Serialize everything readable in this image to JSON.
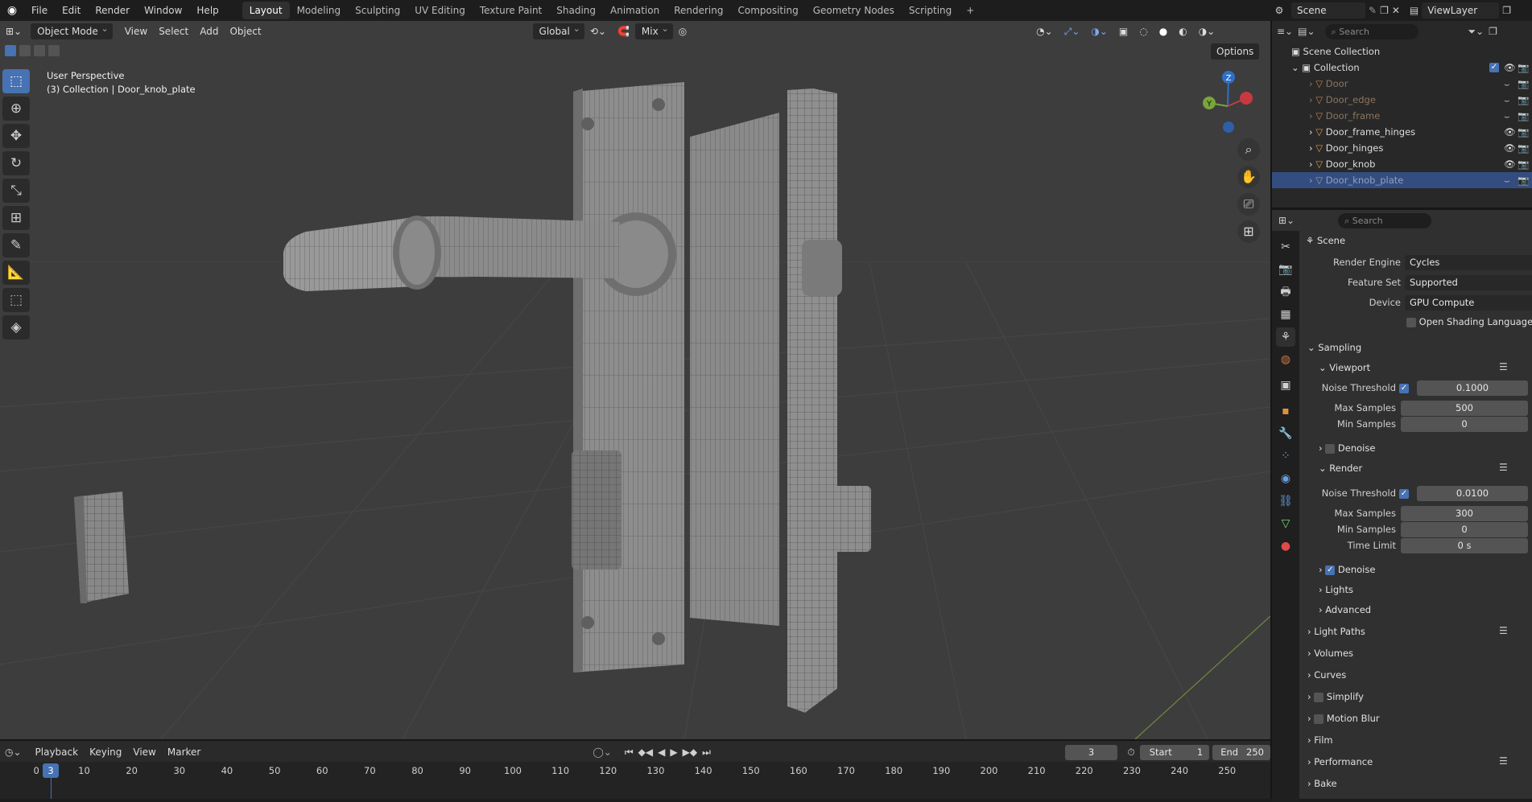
{
  "menu": {
    "items": [
      "File",
      "Edit",
      "Render",
      "Window",
      "Help"
    ]
  },
  "workspaces": [
    {
      "label": "Layout",
      "active": true
    },
    {
      "label": "Modeling"
    },
    {
      "label": "Sculpting"
    },
    {
      "label": "UV Editing"
    },
    {
      "label": "Texture Paint"
    },
    {
      "label": "Shading"
    },
    {
      "label": "Animation"
    },
    {
      "label": "Rendering"
    },
    {
      "label": "Compositing"
    },
    {
      "label": "Geometry Nodes"
    },
    {
      "label": "Scripting"
    }
  ],
  "topright": {
    "scene": "Scene",
    "viewlayer": "ViewLayer"
  },
  "viewport": {
    "mode": "Object Mode",
    "menus": [
      "View",
      "Select",
      "Add",
      "Object"
    ],
    "orientation": "Global",
    "pivot": "Mix",
    "options": "Options",
    "perspective": "User Perspective",
    "context": "(3) Collection | Door_knob_plate",
    "gizmo_labels": {
      "x": "",
      "y": "Y",
      "z": "Z"
    }
  },
  "outliner": {
    "search_placeholder": "Search",
    "root": "Scene Collection",
    "collection": "Collection",
    "items": [
      {
        "name": "Door",
        "visible": false,
        "selected": false
      },
      {
        "name": "Door_edge",
        "visible": false,
        "selected": false
      },
      {
        "name": "Door_frame",
        "visible": false,
        "selected": false
      },
      {
        "name": "Door_frame_hinges",
        "visible": true,
        "selected": false
      },
      {
        "name": "Door_hinges",
        "visible": true,
        "selected": false
      },
      {
        "name": "Door_knob",
        "visible": true,
        "selected": false
      },
      {
        "name": "Door_knob_plate",
        "visible": false,
        "selected": true
      }
    ]
  },
  "properties": {
    "search_placeholder": "Search",
    "context": "Scene",
    "render_engine_label": "Render Engine",
    "render_engine": "Cycles",
    "feature_set_label": "Feature Set",
    "feature_set": "Supported",
    "device_label": "Device",
    "device": "GPU Compute",
    "osl_label": "Open Shading Language",
    "sampling": "Sampling",
    "viewport": "Viewport",
    "vp_noise_label": "Noise Threshold",
    "vp_noise": "0.1000",
    "vp_max_label": "Max Samples",
    "vp_max": "500",
    "vp_min_label": "Min Samples",
    "vp_min": "0",
    "vp_denoise": "Denoise",
    "render": "Render",
    "r_noise_label": "Noise Threshold",
    "r_noise": "0.0100",
    "r_max_label": "Max Samples",
    "r_max": "300",
    "r_min_label": "Min Samples",
    "r_min": "0",
    "r_time_label": "Time Limit",
    "r_time": "0 s",
    "r_denoise": "Denoise",
    "lights": "Lights",
    "advanced": "Advanced",
    "light_paths": "Light Paths",
    "volumes": "Volumes",
    "curves": "Curves",
    "simplify": "Simplify",
    "motion_blur": "Motion Blur",
    "film": "Film",
    "performance": "Performance",
    "bake": "Bake"
  },
  "timeline": {
    "menus": [
      "Playback",
      "Keying",
      "View",
      "Marker"
    ],
    "current_frame": "3",
    "start_label": "Start",
    "start": "1",
    "end_label": "End",
    "end": "250",
    "ticks": [
      "0",
      "10",
      "20",
      "30",
      "40",
      "50",
      "60",
      "70",
      "80",
      "90",
      "100",
      "110",
      "120",
      "130",
      "140",
      "150",
      "160",
      "170",
      "180",
      "190",
      "200",
      "210",
      "220",
      "230",
      "240",
      "250"
    ],
    "playhead": "3"
  }
}
